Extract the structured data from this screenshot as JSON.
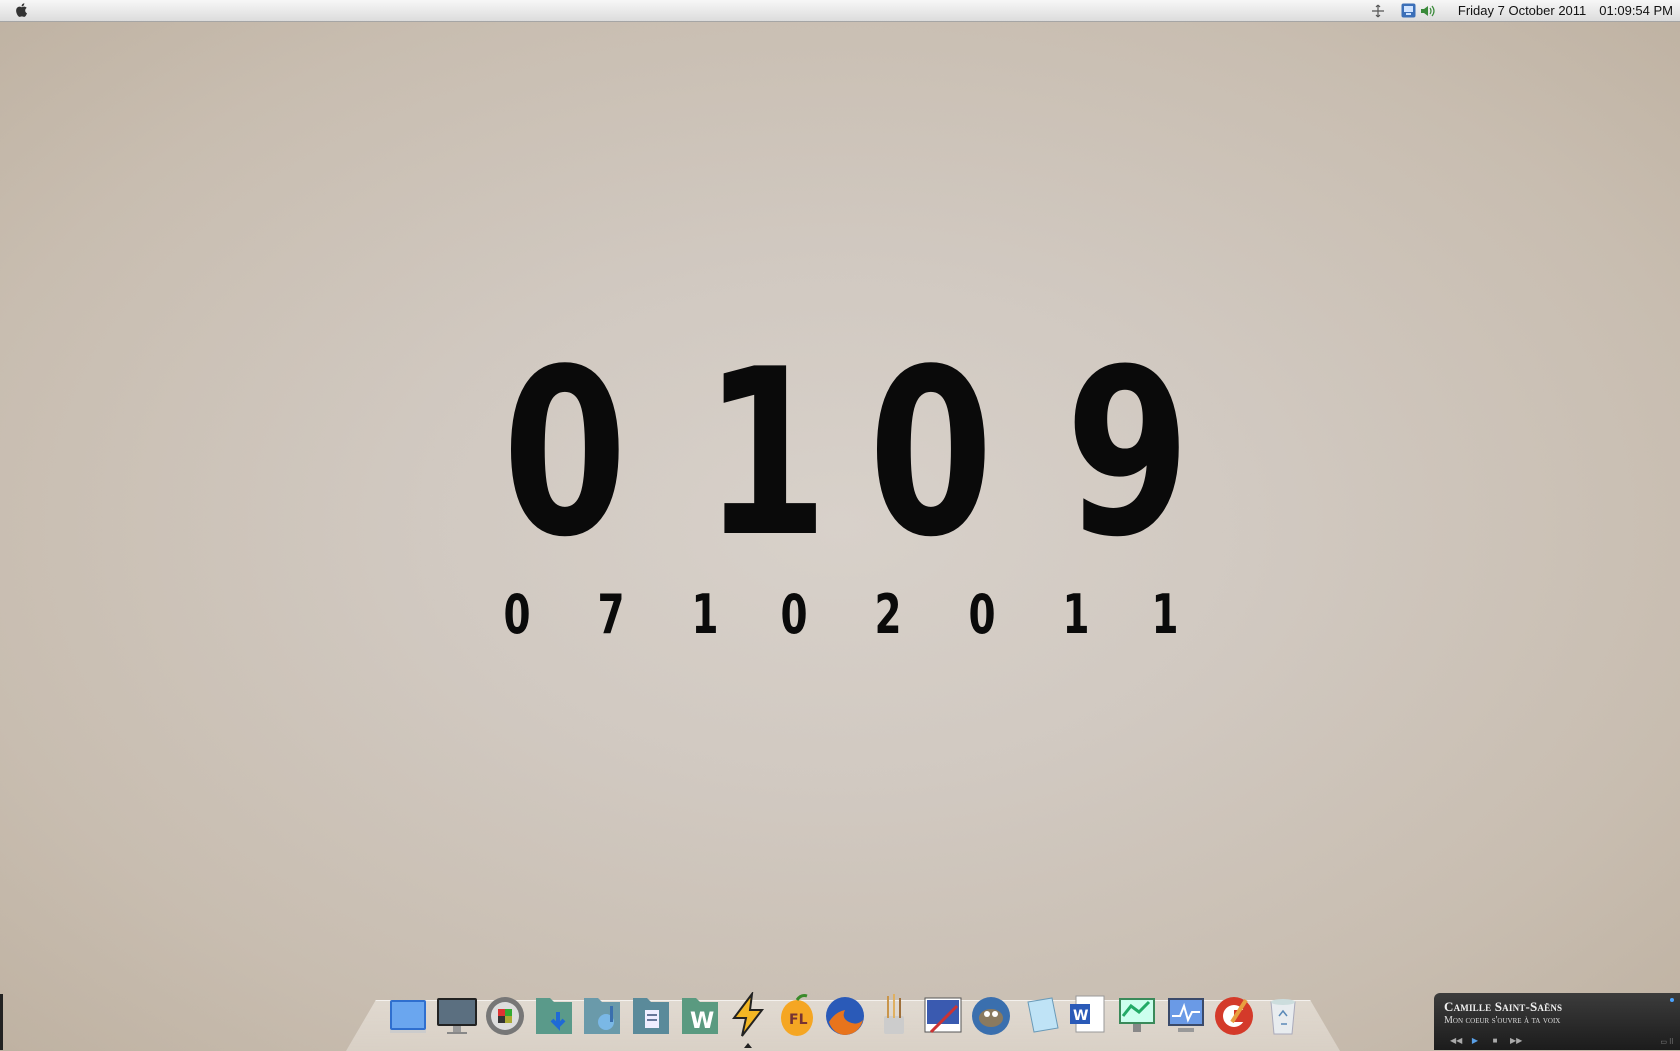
{
  "menubar": {
    "apple_icon": "apple-icon",
    "status_icons": [
      "sync-icon",
      "network-icon",
      "volume-icon"
    ],
    "date": "Friday 7 October 2011",
    "time": "01:09:54 PM"
  },
  "clock": {
    "time_digits": [
      "0",
      "1",
      "0",
      "9"
    ],
    "date_digits": [
      "0",
      "7",
      "1",
      "0",
      "2",
      "0",
      "1",
      "1"
    ]
  },
  "dock": {
    "items": [
      "desktop-icon",
      "monitor-icon",
      "system-preferences-icon",
      "downloads-folder-icon",
      "music-folder-icon",
      "documents-folder-icon",
      "w-folder-icon",
      "winamp-icon",
      "fl-studio-icon",
      "firefox-icon",
      "paint-brushes-icon",
      "photo-editor-icon",
      "gimp-icon",
      "notepad-icon",
      "word-icon",
      "network-monitor-icon",
      "activity-monitor-icon",
      "ccleaner-icon",
      "recycle-bin-icon"
    ],
    "active_index": 7
  },
  "music_widget": {
    "artist": "Camille Saint-Saëns",
    "track": "Mon coeur s'ouvre à ta voix",
    "controls": [
      "previous-icon",
      "play-icon",
      "stop-icon",
      "next-icon"
    ]
  },
  "colors": {
    "background": "#d1c9c1",
    "digits": "#0a0a0a",
    "menubar": "#e8e8e8",
    "widget": "#2a2a2a"
  }
}
